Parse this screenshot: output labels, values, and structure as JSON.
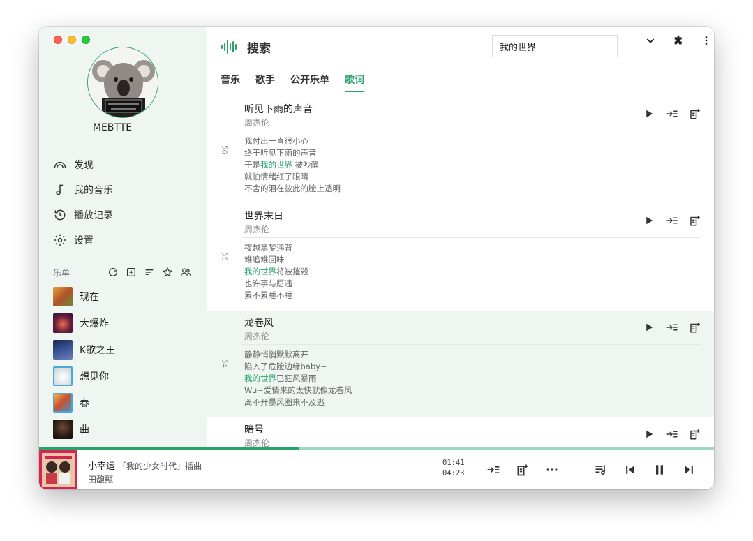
{
  "user": {
    "name": "MEBTTE"
  },
  "nav": [
    {
      "label": "发现",
      "icon": "rainbow-icon"
    },
    {
      "label": "我的音乐",
      "icon": "music-note-icon"
    },
    {
      "label": "播放记录",
      "icon": "history-icon"
    },
    {
      "label": "设置",
      "icon": "gear-icon"
    }
  ],
  "playlists": {
    "title": "乐单",
    "tools": [
      "refresh-icon",
      "add-box-icon",
      "sort-icon",
      "star-icon",
      "people-icon"
    ],
    "items": [
      {
        "label": "现在",
        "color": "#c9842f"
      },
      {
        "label": "大爆炸",
        "color": "#8a2d3c"
      },
      {
        "label": "K歌之王",
        "color": "#2b3b78"
      },
      {
        "label": "想见你",
        "color": "#d9e0e4"
      },
      {
        "label": "春",
        "color": "#d07a3b"
      },
      {
        "label": "曲",
        "color": "#2a1b14"
      }
    ]
  },
  "header": {
    "title": "搜索",
    "search_value": "我的世界",
    "icons": [
      "chevron-down-icon",
      "puzzle-icon",
      "more-vertical-icon"
    ]
  },
  "tabs": [
    {
      "label": "音乐",
      "active": false
    },
    {
      "label": "歌手",
      "active": false
    },
    {
      "label": "公开乐单",
      "active": false
    },
    {
      "label": "歌词",
      "active": true
    }
  ],
  "results": [
    {
      "index": "56",
      "title": "听见下雨的声音",
      "artist": "周杰伦",
      "lyrics": [
        {
          "pre": "我付出一直很小心",
          "hl": "",
          "post": ""
        },
        {
          "pre": "终于听见下雨的声音",
          "hl": "",
          "post": ""
        },
        {
          "pre": "于是",
          "hl": "我的世界",
          "post": " 被吵醒"
        },
        {
          "pre": "就怕情绪红了眼睛",
          "hl": "",
          "post": ""
        },
        {
          "pre": "不舍的泪在彼此的脸上透明",
          "hl": "",
          "post": ""
        }
      ]
    },
    {
      "index": "55",
      "title": "世界末日",
      "artist": "周杰伦",
      "lyrics": [
        {
          "pre": "夜越黑梦违背",
          "hl": "",
          "post": ""
        },
        {
          "pre": "难追难回味",
          "hl": "",
          "post": ""
        },
        {
          "pre": "",
          "hl": "我的世界",
          "post": "将被摧毁"
        },
        {
          "pre": "也许事与愿违",
          "hl": "",
          "post": ""
        },
        {
          "pre": "累不累睡不睡",
          "hl": "",
          "post": ""
        }
      ]
    },
    {
      "index": "54",
      "title": "龙卷风",
      "artist": "周杰伦",
      "lyrics": [
        {
          "pre": "静静悄悄默默离开",
          "hl": "",
          "post": ""
        },
        {
          "pre": "陷入了危险边缘baby~",
          "hl": "",
          "post": ""
        },
        {
          "pre": "",
          "hl": "我的世界",
          "post": "已狂风暴雨"
        },
        {
          "pre": "Wu~爱情来的太快就像龙卷风",
          "hl": "",
          "post": ""
        },
        {
          "pre": "离不开暴风圈来不及逃",
          "hl": "",
          "post": ""
        }
      ]
    },
    {
      "index": "",
      "title": "暗号",
      "artist": "周杰伦",
      "lyrics": []
    }
  ],
  "player": {
    "song": "小幸运",
    "subtitle": "「我的少女时代」插曲",
    "artist": "田馥甄",
    "current_time": "01:41",
    "total_time": "04:23",
    "progress": 0.385,
    "accent": "#2aa36a"
  }
}
